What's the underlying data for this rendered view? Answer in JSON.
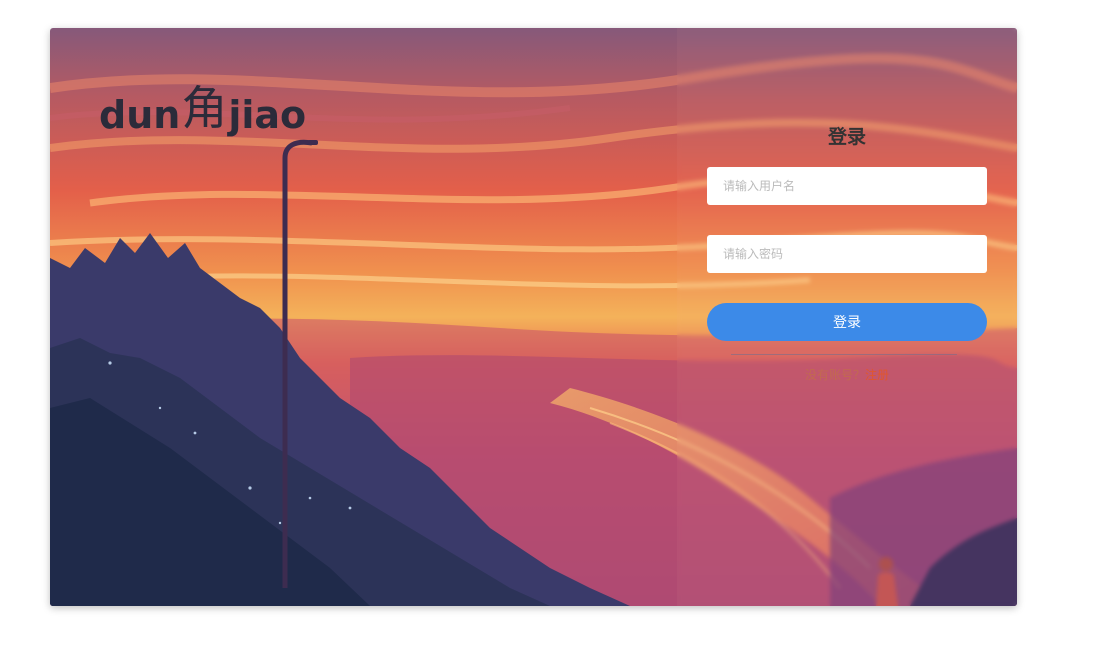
{
  "brand": {
    "logo_left": "dun",
    "logo_mid": "角",
    "logo_right": "jiao"
  },
  "login": {
    "title": "登录",
    "username_placeholder": "请输入用户名",
    "password_placeholder": "请输入密码",
    "submit_label": "登录",
    "register_prompt": "没有账号？",
    "register_link": "注册"
  },
  "colors": {
    "accent": "#3c8ae8",
    "link": "#e0562e",
    "sky_top": "#8a5a7a",
    "sky_mid": "#e8624a",
    "glow": "#f4b25a"
  }
}
